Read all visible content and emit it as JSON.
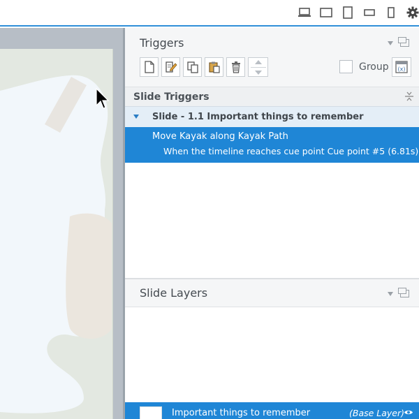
{
  "device_bar": {
    "items": [
      {
        "icon": "laptop-icon"
      },
      {
        "icon": "tablet-landscape-icon"
      },
      {
        "icon": "tablet-portrait-icon"
      },
      {
        "icon": "phone-landscape-icon"
      },
      {
        "icon": "phone-portrait-icon"
      },
      {
        "icon": "gear-icon"
      }
    ]
  },
  "triggers_panel": {
    "title": "Triggers",
    "toolbar": [
      "new-trigger-icon",
      "edit-trigger-icon",
      "copy-icon",
      "paste-icon",
      "delete-icon",
      "move-up-down-icon"
    ],
    "group_label": "Group",
    "section_label": "Slide Triggers",
    "slide_group": "Slide - 1.1 Important things to remember",
    "selected_trigger": {
      "action": "Move Kayak along Kayak Path",
      "condition": "When the timeline reaches cue point Cue point #5 (6.81s)"
    }
  },
  "layers_panel": {
    "title": "Slide Layers",
    "base_layer": {
      "name": "Important things to remember",
      "tag": "(Base Layer)"
    }
  },
  "colors": {
    "accent": "#1f86d6",
    "top_border": "#2f8fd8"
  }
}
